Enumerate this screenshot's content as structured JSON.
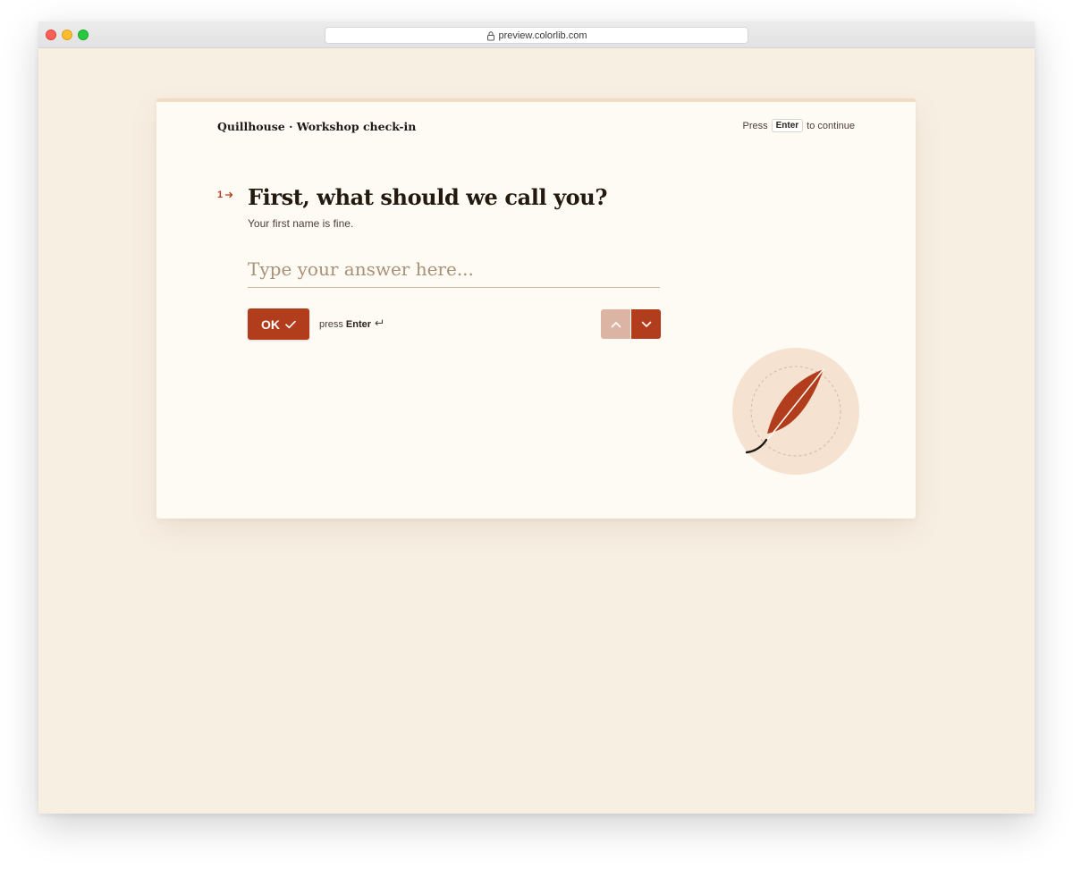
{
  "browser": {
    "url": "preview.colorlib.com"
  },
  "form": {
    "brand": "Quillhouse · Workshop check-in",
    "hint": {
      "prefix": "Press",
      "key": "Enter",
      "suffix": "to continue"
    },
    "question": {
      "number": "1",
      "title": "First, what should we call you?",
      "subtitle": "Your first name is fine.",
      "placeholder": "Type your answer here...",
      "value": ""
    },
    "ok_label": "OK",
    "press_prefix": "press",
    "press_key": "Enter"
  },
  "colors": {
    "accent": "#b23d1d",
    "accent_light": "#dbb4a4",
    "page_bg": "#f8efe3",
    "card_bg": "#fefaf4",
    "circle_bg": "#f5e2d0"
  },
  "icons": {
    "lock": "lock-icon",
    "arrow": "arrow-right-icon",
    "check": "check-icon",
    "enter": "return-icon",
    "up": "chevron-up-icon",
    "down": "chevron-down-icon",
    "feather": "quill-feather-icon"
  }
}
